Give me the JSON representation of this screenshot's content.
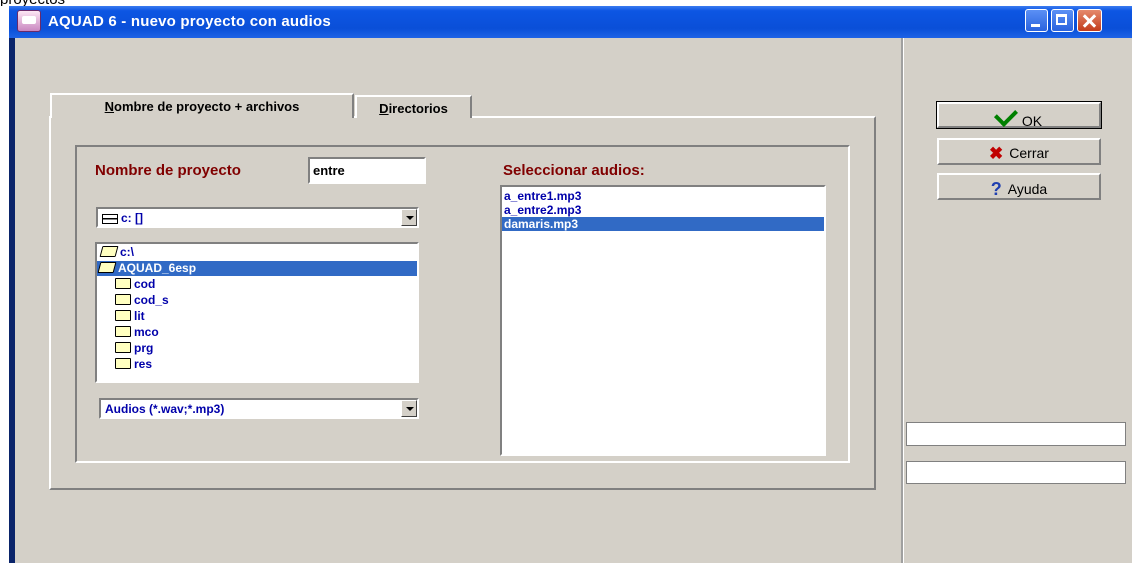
{
  "window": {
    "title": "AQUAD 6 - nuevo proyecto con audios",
    "top_strip_text": "proyectos"
  },
  "tabs": [
    {
      "label": "Nombre de proyecto + archivos",
      "mnemonic": "N",
      "rest": "ombre de proyecto + archivos",
      "active": true
    },
    {
      "label": "Directorios",
      "mnemonic": "D",
      "rest": "irectorios",
      "active": false
    }
  ],
  "project": {
    "label": "Nombre de proyecto",
    "value": "entre"
  },
  "drive": {
    "value": "c: []"
  },
  "folders": {
    "items": [
      {
        "name": "c:\\",
        "icon": "open-folder-icon",
        "selected": false,
        "indent": 0
      },
      {
        "name": "AQUAD_6esp",
        "icon": "open-folder-icon",
        "selected": true,
        "indent": 1
      },
      {
        "name": "cod",
        "icon": "folder-icon",
        "selected": false,
        "indent": 2
      },
      {
        "name": "cod_s",
        "icon": "folder-icon",
        "selected": false,
        "indent": 2
      },
      {
        "name": "lit",
        "icon": "folder-icon",
        "selected": false,
        "indent": 2
      },
      {
        "name": "mco",
        "icon": "folder-icon",
        "selected": false,
        "indent": 2
      },
      {
        "name": "prg",
        "icon": "folder-icon",
        "selected": false,
        "indent": 2
      },
      {
        "name": "res",
        "icon": "folder-icon",
        "selected": false,
        "indent": 2
      }
    ]
  },
  "filter": {
    "value": "Audios (*.wav;*.mp3)"
  },
  "audios": {
    "label": "Seleccionar audios:",
    "items": [
      {
        "name": "a_entre1.mp3",
        "selected": false
      },
      {
        "name": "a_entre2.mp3",
        "selected": false
      },
      {
        "name": "damaris.mp3",
        "selected": true
      }
    ]
  },
  "buttons": {
    "ok": "OK",
    "cerrar": "Cerrar",
    "ayuda": "Ayuda"
  },
  "colors": {
    "selection": "#316ac5",
    "label_dark_red": "#800000",
    "list_text_blue": "#0000aa",
    "titlebar_blue": "#0a4fd8"
  }
}
